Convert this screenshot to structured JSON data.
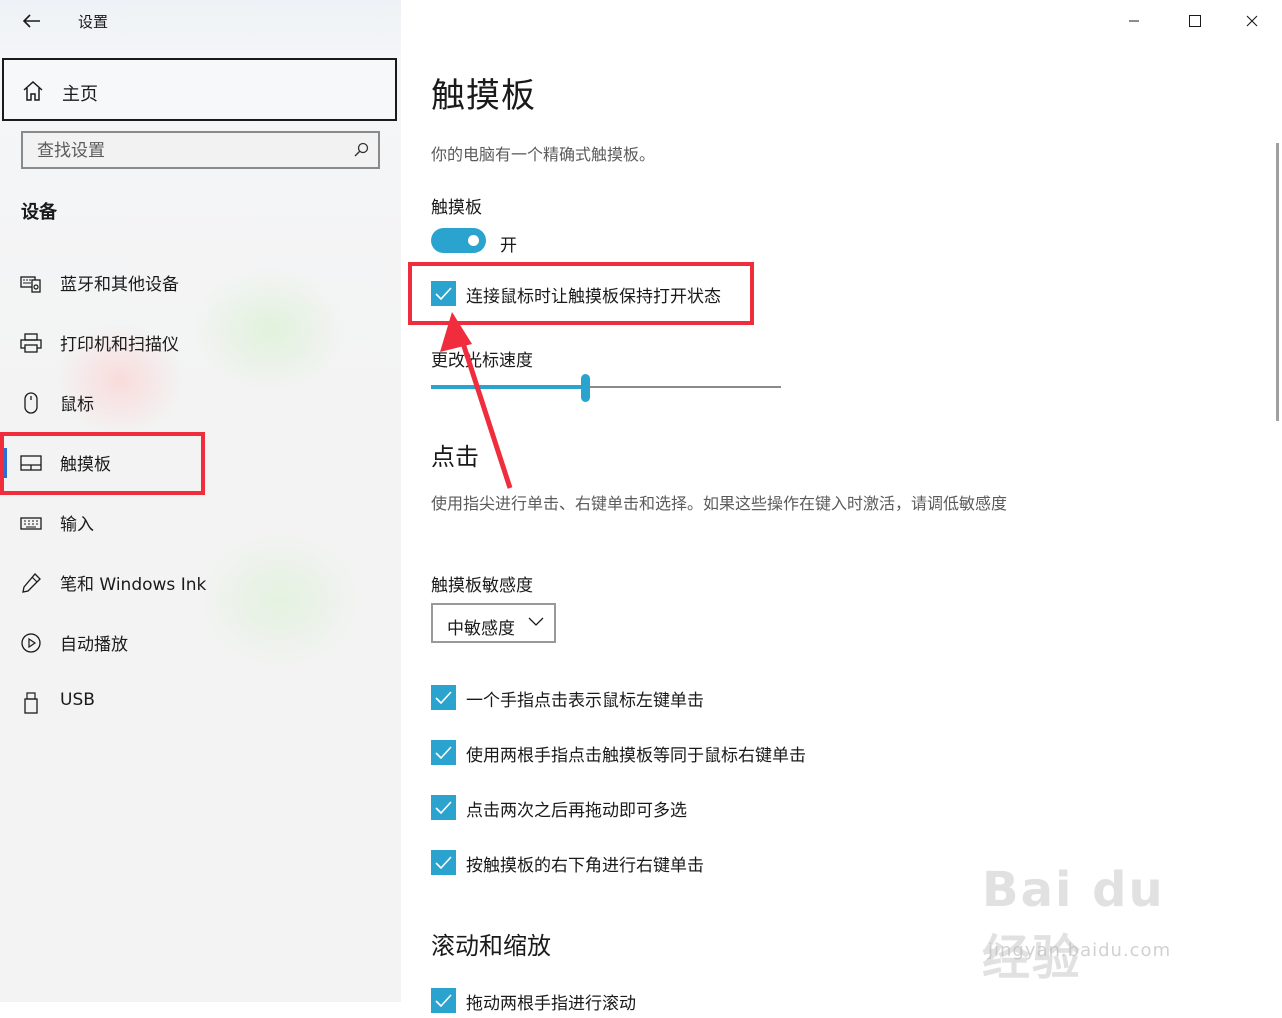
{
  "app": {
    "title": "设置"
  },
  "sidebar": {
    "home_label": "主页",
    "search_placeholder": "查找设置",
    "section_title": "设备",
    "items": [
      {
        "label": "蓝牙和其他设备",
        "icon": "bluetooth-devices-icon"
      },
      {
        "label": "打印机和扫描仪",
        "icon": "printer-icon"
      },
      {
        "label": "鼠标",
        "icon": "mouse-icon"
      },
      {
        "label": "触摸板",
        "icon": "touchpad-icon",
        "active": true
      },
      {
        "label": "输入",
        "icon": "keyboard-icon"
      },
      {
        "label": "笔和 Windows Ink",
        "icon": "pen-icon"
      },
      {
        "label": "自动播放",
        "icon": "autoplay-icon"
      },
      {
        "label": "USB",
        "icon": "usb-icon"
      }
    ]
  },
  "window_controls": [
    "minimize",
    "maximize",
    "close"
  ],
  "main": {
    "title": "触摸板",
    "description": "你的电脑有一个精确式触摸板。",
    "touchpad_label": "触摸板",
    "toggle_state": "开",
    "keep_on_checkbox": "连接鼠标时让触摸板保持打开状态",
    "cursor_speed_label": "更改光标速度",
    "cursor_speed_fraction": 0.44,
    "taps_heading": "点击",
    "taps_description": "使用指尖进行单击、右键单击和选择。如果这些操作在键入时激活，请调低敏感度",
    "sensitivity_label": "触摸板敏感度",
    "sensitivity_value": "中敏感度",
    "tap_options": [
      "一个手指点击表示鼠标左键单击",
      "使用两根手指点击触摸板等同于鼠标右键单击",
      "点击两次之后再拖动即可多选",
      "按触摸板的右下角进行右键单击"
    ],
    "scroll_heading": "滚动和缩放",
    "scroll_first_option": "拖动两根手指进行滚动"
  },
  "colors": {
    "accent": "#2aa3cf",
    "highlight": "#ef2d3c"
  },
  "watermark": {
    "brand": "Bai du 经验",
    "url": "jingyan.baidu.com"
  }
}
